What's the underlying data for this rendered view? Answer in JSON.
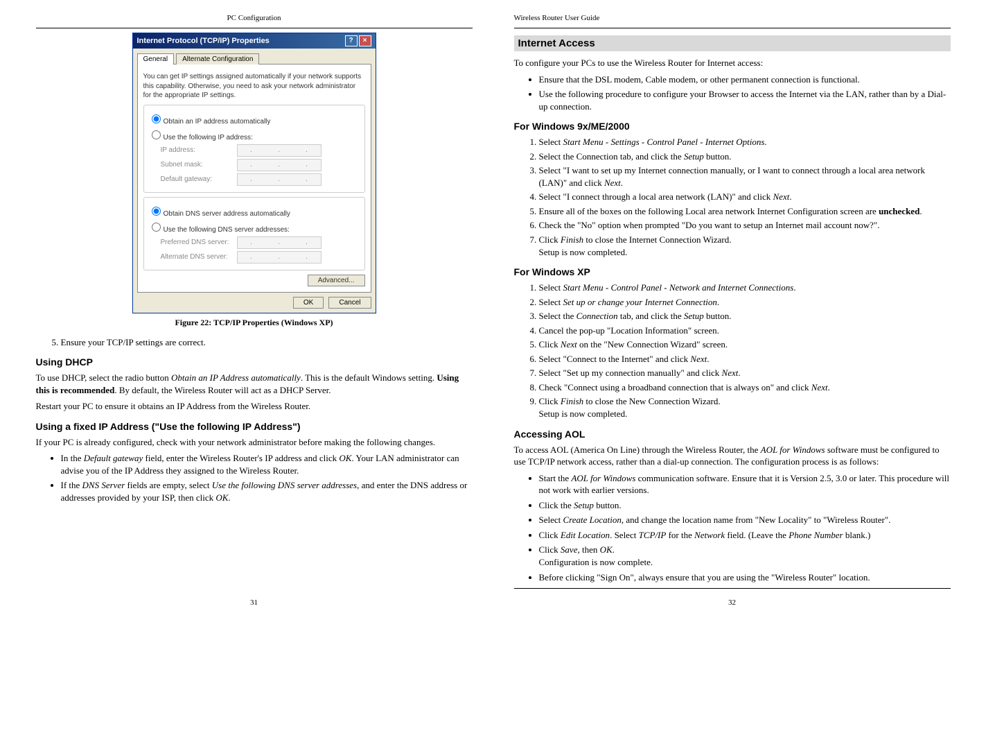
{
  "left": {
    "header": "PC Configuration",
    "dialog": {
      "title": "Internet Protocol (TCP/IP) Properties",
      "tab1": "General",
      "tab2": "Alternate Configuration",
      "intro": "You can get IP settings assigned automatically if your network supports this capability. Otherwise, you need to ask your network administrator for the appropriate IP settings.",
      "r1": "Obtain an IP address automatically",
      "r2": "Use the following IP address:",
      "f1": "IP address:",
      "f2": "Subnet mask:",
      "f3": "Default gateway:",
      "r3": "Obtain DNS server address automatically",
      "r4": "Use the following DNS server addresses:",
      "f4": "Preferred DNS server:",
      "f5": "Alternate DNS server:",
      "adv": "Advanced...",
      "ok": "OK",
      "cancel": "Cancel"
    },
    "caption": "Figure 22: TCP/IP Properties (Windows XP)",
    "step5": "Ensure your TCP/IP settings are correct.",
    "h_dhcp": "Using DHCP",
    "p_dhcp1a": "To use DHCP, select the radio button ",
    "p_dhcp1b": "Obtain an IP Address automatically",
    "p_dhcp1c": ". This is the default Windows setting. ",
    "p_dhcp1d": "Using this is recommended",
    "p_dhcp1e": ". By default, the Wireless Router will act as a DHCP Server.",
    "p_dhcp2": "Restart your PC to ensure it obtains an IP Address from the Wireless Router.",
    "h_fixed": "Using a fixed IP Address (\"Use the following IP Address\")",
    "p_fixed": "If your PC is already configured, check with your network administrator before making the following changes.",
    "b1a": "In the ",
    "b1b": "Default gateway",
    "b1c": " field, enter the Wireless Router's IP address and click ",
    "b1d": "OK",
    "b1e": ". Your LAN administrator can advise you of the IP Address they assigned to the Wireless Router.",
    "b2a": "If the ",
    "b2b": "DNS Server",
    "b2c": " fields are empty, select ",
    "b2d": "Use the following DNS server addresses",
    "b2e": ", and enter the DNS address or addresses provided by your ISP, then click ",
    "b2f": "OK",
    "b2g": ".",
    "pagenum": "31"
  },
  "right": {
    "header": "Wireless Router User Guide",
    "h_internet": "Internet Access",
    "p_intro": "To configure your PCs to use the Wireless Router for Internet access:",
    "b_intro1": "Ensure that the DSL modem, Cable modem, or other permanent connection is functional.",
    "b_intro2": "Use the following procedure to configure your Browser to access the Internet via the LAN, rather than by a Dial-up connection.",
    "h_9x": "For Windows 9x/ME/2000",
    "w9": {
      "s1a": "Select ",
      "s1b": "Start Menu - Settings - Control Panel - Internet Options",
      "s1c": ".",
      "s2a": "Select the Connection tab, and click the ",
      "s2b": "Setup",
      "s2c": " button.",
      "s3a": "Select \"I want to set up my Internet connection manually, or I want to connect through a local area network (LAN)\" and click ",
      "s3b": "Next",
      "s3c": ".",
      "s4a": "Select \"I connect through a local area network (LAN)\" and click ",
      "s4b": "Next",
      "s4c": ".",
      "s5a": "Ensure all of the boxes on the following Local area network Internet Configuration screen are ",
      "s5b": "unchecked",
      "s5c": ".",
      "s6": "Check the \"No\" option when prompted \"Do you want to setup an Internet mail account now?\".",
      "s7a": "Click ",
      "s7b": "Finish",
      "s7c": " to close the Internet Connection Wizard.",
      "s7d": "Setup is now completed."
    },
    "h_xp": "For Windows XP",
    "xp": {
      "s1a": "Select ",
      "s1b": "Start Menu - Control Panel - Network and Internet Connections",
      "s1c": ".",
      "s2a": "Select ",
      "s2b": "Set up or change your Internet Connection",
      "s2c": ".",
      "s3a": "Select the ",
      "s3b": "Connection",
      "s3c": " tab, and click the ",
      "s3d": "Setup",
      "s3e": " button.",
      "s4": "Cancel the pop-up \"Location Information\" screen.",
      "s5a": "Click ",
      "s5b": "Next",
      "s5c": " on the \"New Connection Wizard\" screen.",
      "s6a": "Select \"Connect to the Internet\" and click ",
      "s6b": "Next",
      "s6c": ".",
      "s7a": "Select \"Set up my connection manually\" and click ",
      "s7b": "Next",
      "s7c": ".",
      "s8a": "Check \"Connect using a broadband connection that is always on\" and click ",
      "s8b": "Next",
      "s8c": ".",
      "s9a": "Click ",
      "s9b": "Finish",
      "s9c": " to close the New Connection Wizard.",
      "s9d": "Setup is now completed."
    },
    "h_aol": "Accessing AOL",
    "p_aol1a": "To access AOL (America On Line) through the Wireless Router, the ",
    "p_aol1b": "AOL for Windows",
    "p_aol1c": " software must be configured to use TCP/IP network access, rather than a dial-up connection. The configuration process is as follows:",
    "aol": {
      "b1a": "Start the ",
      "b1b": "AOL for Windows",
      "b1c": " communication software. Ensure that it is Version 2.5, 3.0 or later. This procedure will not work with earlier versions.",
      "b2a": "Click the ",
      "b2b": "Setup",
      "b2c": " button.",
      "b3a": "Select ",
      "b3b": "Create Location",
      "b3c": ", and change the location name from \"New Locality\" to \"Wireless Router\".",
      "b4a": "Click ",
      "b4b": "Edit Location",
      "b4c": ". Select ",
      "b4d": "TCP/IP",
      "b4e": " for the ",
      "b4f": "Network",
      "b4g": " field. (Leave the ",
      "b4h": "Phone Number",
      "b4i": " blank.)",
      "b5a": "Click ",
      "b5b": "Save",
      "b5c": ", then ",
      "b5d": "OK",
      "b5e": ".",
      "b5f": "Configuration is now complete.",
      "b6": "Before clicking \"Sign On\", always ensure that you are using the \"Wireless Router\" location."
    },
    "pagenum": "32"
  }
}
